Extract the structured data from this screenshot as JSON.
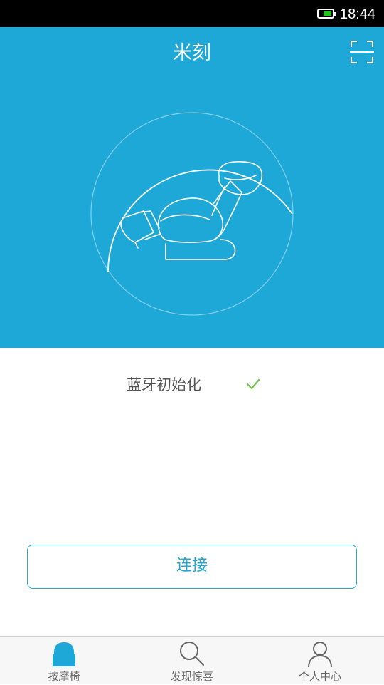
{
  "status_bar": {
    "time": "18:44",
    "battery_icon": "battery-icon",
    "battery_level_color": "#22c51c"
  },
  "header": {
    "title": "米刻",
    "scan_icon": "scan-icon",
    "background_color": "#1ea8d8"
  },
  "hero": {
    "illustration": "massage-chair-icon",
    "progress_ring_icon": "progress-ring"
  },
  "status": {
    "label": "蓝牙初始化",
    "state_icon": "check-icon",
    "state_color": "#6cc24a"
  },
  "actions": {
    "connect_label": "连接"
  },
  "tabbar": {
    "items": [
      {
        "label": "按摩椅",
        "icon": "massage-chair-tab-icon",
        "active": true
      },
      {
        "label": "发现惊喜",
        "icon": "search-icon",
        "active": false
      },
      {
        "label": "个人中心",
        "icon": "person-icon",
        "active": false
      }
    ],
    "active_color": "#1ea8d8",
    "inactive_color": "#666666"
  }
}
